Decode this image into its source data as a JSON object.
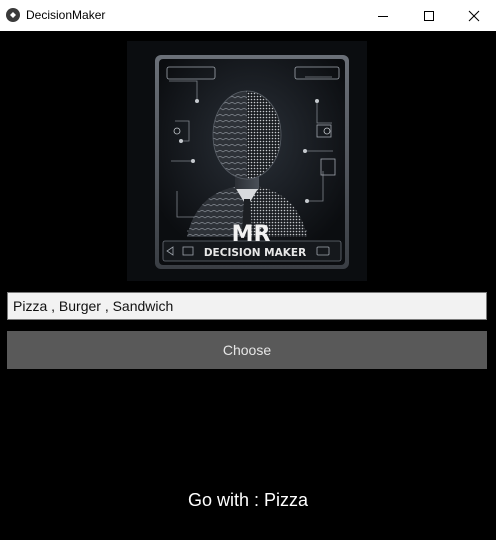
{
  "window": {
    "title": "DecisionMaker",
    "minimize_icon": "minimize-icon",
    "maximize_icon": "maximize-icon",
    "close_icon": "close-icon"
  },
  "logo": {
    "initials": "MR",
    "caption": "DECISION MAKER"
  },
  "input": {
    "value": "Pizza , Burger , Sandwich"
  },
  "choose_button": {
    "label": "Choose"
  },
  "result": {
    "text": "Go with : Pizza"
  },
  "colors": {
    "background": "#000000",
    "button": "#595959",
    "input_background": "#f2f2f2",
    "result_text": "#ffffff"
  }
}
